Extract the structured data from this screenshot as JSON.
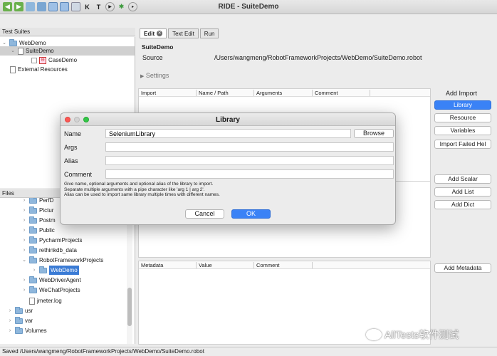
{
  "window": {
    "title": "RIDE - SuiteDemo"
  },
  "toolbar": {
    "k_label": "K",
    "t_label": "T"
  },
  "test_suites": {
    "header": "Test Suites",
    "items": [
      {
        "label": "WebDemo"
      },
      {
        "label": "SuiteDemo"
      },
      {
        "label": "CaseDemo"
      },
      {
        "label": "External Resources"
      }
    ]
  },
  "files": {
    "header": "Files",
    "items": [
      {
        "label": "PerfD"
      },
      {
        "label": "Pictur"
      },
      {
        "label": "Postm"
      },
      {
        "label": "Public"
      },
      {
        "label": "PycharmProjects"
      },
      {
        "label": "rethinkdb_data"
      },
      {
        "label": "RobotFrameworkProjects"
      },
      {
        "label": "WebDemo"
      },
      {
        "label": "WebDriverAgent"
      },
      {
        "label": "WeChatProjects"
      },
      {
        "label": "jmeter.log"
      },
      {
        "label": "usr"
      },
      {
        "label": "var"
      },
      {
        "label": "Volumes"
      }
    ]
  },
  "tabs": [
    {
      "label": "Edit"
    },
    {
      "label": "Text Edit"
    },
    {
      "label": "Run"
    }
  ],
  "editor": {
    "suite_name": "SuiteDemo",
    "source_label": "Source",
    "source_path": "/Users/wangmeng/RobotFrameworkProjects/WebDemo/SuiteDemo.robot",
    "settings_label": "Settings",
    "import_headers": [
      "Import",
      "Name / Path",
      "Arguments",
      "Comment"
    ],
    "metadata_headers": [
      "Metadata",
      "Value",
      "Comment"
    ],
    "add_import_label": "Add Import",
    "buttons": {
      "library": "Library",
      "resource": "Resource",
      "variables": "Variables",
      "import_failed": "Import Failed Hel",
      "add_scalar": "Add Scalar",
      "add_list": "Add List",
      "add_dict": "Add Dict",
      "add_metadata": "Add Metadata"
    }
  },
  "dialog": {
    "title": "Library",
    "name_label": "Name",
    "name_value": "SeleniumLibrary",
    "browse_label": "Browse",
    "args_label": "Args",
    "alias_label": "Alias",
    "comment_label": "Comment",
    "help_lines": [
      "Give name, optional arguments and optional alias of the library to import.",
      "Separate multiple arguments with a pipe character like 'arg 1 | arg 2'.",
      "Alias can be used to import same library multiple times with different names."
    ],
    "cancel_label": "Cancel",
    "ok_label": "OK"
  },
  "status": {
    "text": "Saved /Users/wangmeng/RobotFrameworkProjects/WebDemo/SuiteDemo.robot"
  },
  "watermark": {
    "text": "AllTests软件测试"
  }
}
